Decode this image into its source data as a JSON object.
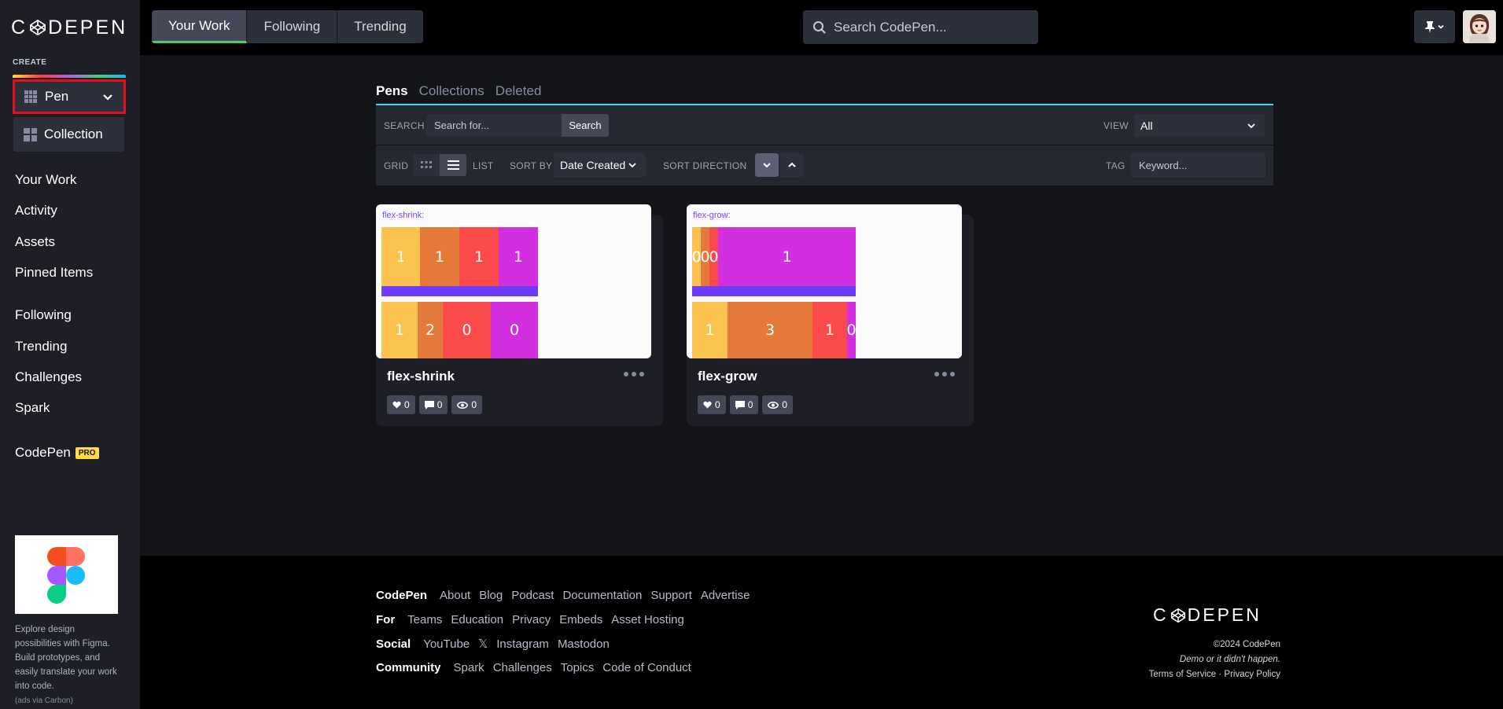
{
  "sidebar": {
    "logo_text": "C◇DEPEN",
    "create_label": "CREATE",
    "create_pen": "Pen",
    "create_collection": "Collection",
    "nav": [
      "Your Work",
      "Activity",
      "Assets",
      "Pinned Items",
      "Following",
      "Trending",
      "Challenges",
      "Spark",
      "CodePen"
    ],
    "pro_badge": "PRO",
    "ad_text": "Explore design possibilities with Figma. Build prototypes, and easily translate your work into code.",
    "ad_via": "(ads via Carbon)"
  },
  "topbar": {
    "tabs": [
      "Your Work",
      "Following",
      "Trending"
    ],
    "active_tab": "Your Work",
    "search_placeholder": "Search CodePen..."
  },
  "main": {
    "subtabs": [
      "Pens",
      "Collections",
      "Deleted"
    ],
    "search_label": "SEARCH",
    "search_placeholder": "Search for...",
    "search_button": "Search",
    "view_label": "VIEW",
    "view_value": "All",
    "grid_label": "GRID",
    "list_label": "LIST",
    "sort_by_label": "SORT BY",
    "sort_by_value": "Date Created",
    "sort_direction_label": "SORT DIRECTION",
    "tag_label": "TAG",
    "tag_placeholder": "Keyword...",
    "cards": [
      {
        "title": "flex-shrink",
        "preview_title": "flex-shrink:",
        "row1": [
          "1",
          "1",
          "1",
          "1"
        ],
        "row2": [
          "1",
          "2",
          "0",
          "0"
        ],
        "likes": "0",
        "comments": "0",
        "views": "0"
      },
      {
        "title": "flex-grow",
        "preview_title": "flex-grow:",
        "row1": [
          "0",
          "0",
          "0",
          "1"
        ],
        "row2": [
          "1",
          "3",
          "1",
          "0"
        ],
        "likes": "0",
        "comments": "0",
        "views": "0"
      }
    ]
  },
  "footer": {
    "rows": [
      {
        "head": "CodePen",
        "links": [
          "About",
          "Blog",
          "Podcast",
          "Documentation",
          "Support",
          "Advertise"
        ]
      },
      {
        "head": "For",
        "links": [
          "Teams",
          "Education",
          "Privacy",
          "Embeds",
          "Asset Hosting"
        ]
      },
      {
        "head": "Social",
        "links": [
          "YouTube",
          "𝕏",
          "Instagram",
          "Mastodon"
        ]
      },
      {
        "head": "Community",
        "links": [
          "Spark",
          "Challenges",
          "Topics",
          "Code of Conduct"
        ]
      }
    ],
    "logo_text": "C◇DEPEN",
    "copyright": "©2024 CodePen",
    "tagline": "Demo or it didn't happen.",
    "terms": "Terms of Service · Privacy Policy"
  },
  "colors": {
    "accent_green": "#47cf73",
    "accent_blue": "#47cfff",
    "highlight_red": "#e60f1a",
    "pro_yellow": "#ffdd40"
  }
}
